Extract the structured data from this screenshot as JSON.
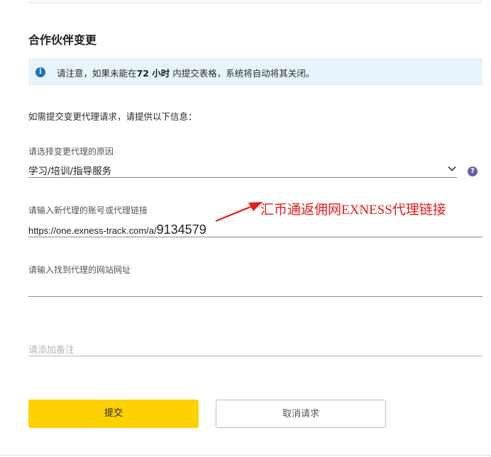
{
  "form": {
    "title": "合作伙伴变更",
    "notice": {
      "icon": "info-icon",
      "text_before": "请注意，如果未能在",
      "text_bold": "72 小时",
      "text_after": "内提交表格，系统将自动将其关闭。"
    },
    "intro": "如需提交变更代理请求，请提供以下信息：",
    "reason_field": {
      "label": "请选择变更代理的原因",
      "value": "学习/培训/指导服务",
      "help_glyph": "?"
    },
    "agent_link_field": {
      "label": "请输入新代理的账号或代理链接",
      "value_prefix": "https://one.exness-track.com/a/",
      "value_id": "9134579"
    },
    "website_field": {
      "label": "请输入找到代理的网站网址",
      "value": ""
    },
    "note_field": {
      "placeholder": "请添加备注"
    },
    "buttons": {
      "submit": "提交",
      "cancel": "取消请求"
    }
  },
  "annotation": {
    "text": "汇币通返佣网EXNESS代理链接",
    "color": "#e61b1b"
  },
  "colors": {
    "submit_bg": "#ffd100",
    "notice_bg": "#e8f4fb",
    "info_icon": "#1a73c5",
    "help_icon": "#6a5fa8"
  }
}
